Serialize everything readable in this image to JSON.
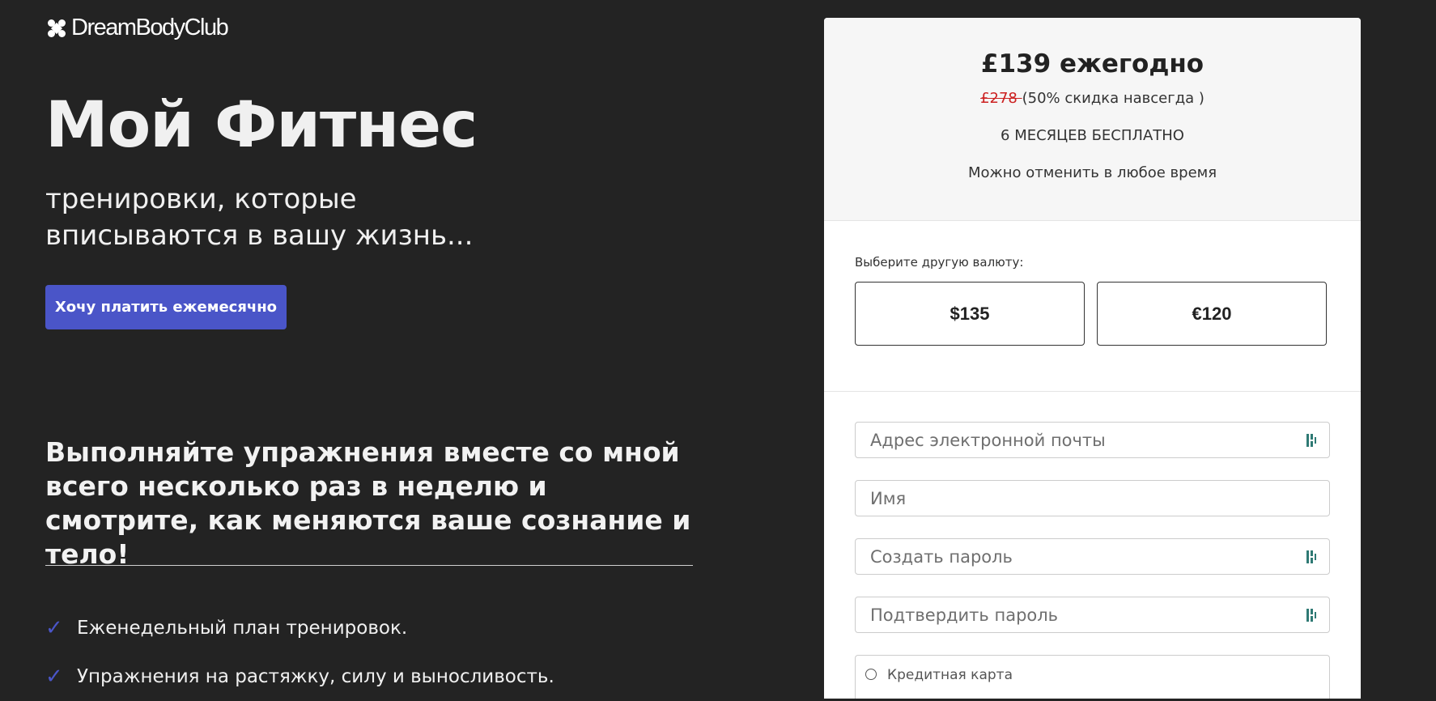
{
  "brand": {
    "name": "DreamBodyClub",
    "logo_icon": "brand-mark-icon"
  },
  "hero": {
    "title": "Мой Фитнес",
    "subtitle": "тренировки, которые вписываются в вашу жизнь...",
    "monthly_button": "Хочу платить ежемесячно"
  },
  "tagline": "Выполняйте упражнения вместе со мной всего несколько раз в неделю и смотрите, как меняются ваше сознание и тело!",
  "features": [
    {
      "icon": "check-icon",
      "text": "Еженедельный план тренировок."
    },
    {
      "icon": "check-icon",
      "text": "Упражнения на растяжку, силу и выносливость."
    }
  ],
  "pricing": {
    "price": "£139 ежегодно",
    "old_price": "£278 ",
    "discount": "(50% скидка навсегда )",
    "free_months": "6 МЕСЯЦЕВ БЕСПЛАТНО",
    "cancel_note": "Можно отменить в любое время"
  },
  "currency": {
    "label": "Выберите другую валюту:",
    "options": [
      "$135",
      "€120"
    ]
  },
  "form": {
    "email_placeholder": "Адрес электронной почты",
    "name_placeholder": "Имя",
    "password_placeholder": "Создать пароль",
    "confirm_placeholder": "Подтвердить пароль",
    "payment_option": "Кредитная карта"
  },
  "colors": {
    "background": "#232323",
    "accent": "#4a55c8",
    "card": "#ffffff",
    "strike": "#cc2020"
  }
}
